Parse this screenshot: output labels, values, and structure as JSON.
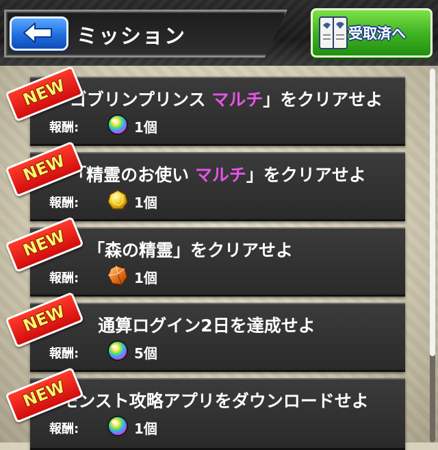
{
  "header": {
    "title": "ミッション",
    "received_button_label": "受取済へ"
  },
  "missions": [
    {
      "badge": "NEW",
      "title_prefix": "「ゴブリンプリンス ",
      "title_highlight": "マルチ",
      "title_suffix": "」をクリアせよ",
      "reward_label": "報酬:",
      "reward_icon": "rainbow-orb-icon",
      "reward_count": "1個"
    },
    {
      "badge": "NEW",
      "title_prefix": "「精霊のお使い ",
      "title_highlight": "マルチ",
      "title_suffix": "」をクリアせよ",
      "reward_label": "報酬:",
      "reward_icon": "gold-egg-icon",
      "reward_count": "1個"
    },
    {
      "badge": "NEW",
      "title_prefix": "「森の精霊」をクリアせよ",
      "title_highlight": "",
      "title_suffix": "",
      "reward_label": "報酬:",
      "reward_icon": "orange-crystal-icon",
      "reward_count": "1個"
    },
    {
      "badge": "NEW",
      "title_prefix": "通算ログイン2日を達成せよ",
      "title_highlight": "",
      "title_suffix": "",
      "reward_label": "報酬:",
      "reward_icon": "rainbow-orb-icon",
      "reward_count": "5個"
    },
    {
      "badge": "NEW",
      "title_prefix": "モンスト攻略アプリをダウンロードせよ",
      "title_highlight": "",
      "title_suffix": "",
      "reward_label": "報酬:",
      "reward_icon": "rainbow-orb-icon",
      "reward_count": "1個"
    }
  ],
  "colors": {
    "highlight": "#e455e8",
    "badge_red": "#d10d0d",
    "badge_text": "#fff36b",
    "back_blue": "#1f6fe0",
    "received_green": "#3fb522"
  }
}
